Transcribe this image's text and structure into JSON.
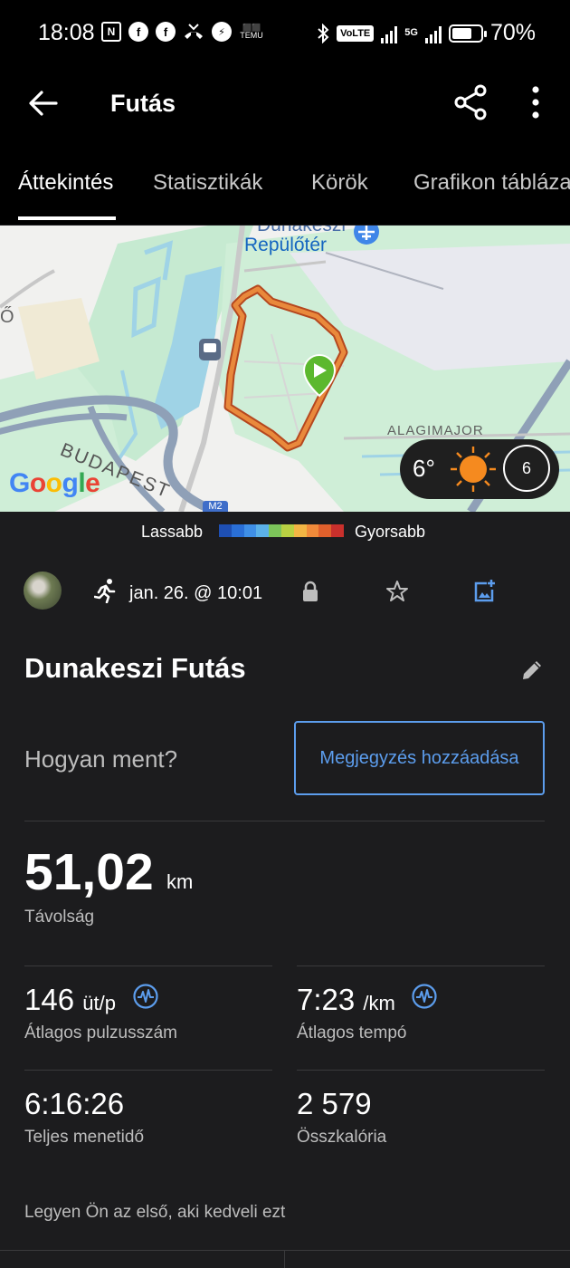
{
  "status_bar": {
    "time": "18:08",
    "volte": "VoLTE",
    "network": "5G",
    "battery": "70%",
    "battery_level": 0.7,
    "temu": "TEMU"
  },
  "app_bar": {
    "title": "Futás"
  },
  "tabs": [
    {
      "label": "Áttekintés",
      "active": true
    },
    {
      "label": "Statisztikák",
      "active": false
    },
    {
      "label": "Körök",
      "active": false
    },
    {
      "label": "Grafikon tábláza",
      "active": false
    }
  ],
  "map": {
    "label_airport": "Dunakeszi Repülőtér",
    "label_airport_line1": "Dunakeszi",
    "label_airport_line2": "Repülőtér",
    "label_alagimajor": "ALAGIMAJOR",
    "label_budapest": "BUDAPEST",
    "label_o": "Ő",
    "google": [
      "G",
      "o",
      "o",
      "g",
      "l",
      "e"
    ],
    "road_badge": "M2",
    "weather": {
      "temperature": "6°",
      "wind": "6"
    }
  },
  "pace_legend": {
    "slow": "Lassabb",
    "fast": "Gyorsabb",
    "colors": [
      "#1e4fb3",
      "#2a6fd6",
      "#3f8fe6",
      "#5bb1e8",
      "#7cc45a",
      "#b8d042",
      "#f2b544",
      "#f08a3a",
      "#e0602c",
      "#c9302c"
    ]
  },
  "activity": {
    "date": "jan. 26. @ 10:01",
    "name": "Dunakeszi Futás",
    "how_prompt": "Hogyan ment?",
    "add_note_label": "Megjegyzés hozzáadása"
  },
  "stats": {
    "distance": {
      "value": "51,02",
      "unit": "km",
      "label": "Távolság"
    },
    "avg_hr": {
      "value": "146",
      "unit": "üt/p",
      "label": "Átlagos pulzusszám"
    },
    "avg_pace": {
      "value": "7:23",
      "unit": "/km",
      "label": "Átlagos tempó"
    },
    "total_time": {
      "value": "6:16:26",
      "label": "Teljes menetidő"
    },
    "calories": {
      "value": "2 579",
      "label": "Összkalória"
    }
  },
  "likes": {
    "text": "Legyen Ön az első, aki kedveli ezt"
  },
  "colors": {
    "accent": "#5c9ded",
    "background": "#1c1c1e",
    "route": "#e2752f",
    "start_marker": "#5cb82e"
  }
}
